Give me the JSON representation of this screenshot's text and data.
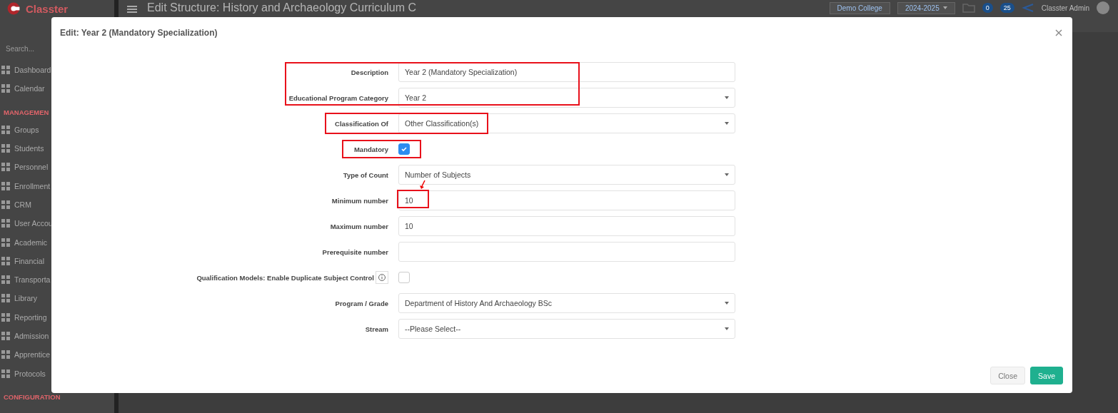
{
  "app": {
    "brand": "Classter",
    "search_placeholder": "Search...",
    "page_title": "Edit Structure: History and Archaeology Curriculum C"
  },
  "sidebar": {
    "items": [
      {
        "kind": "item",
        "label": "Dashboard"
      },
      {
        "kind": "item",
        "label": "Calendar"
      },
      {
        "kind": "heading",
        "label": "MANAGEMEN"
      },
      {
        "kind": "item",
        "label": "Groups"
      },
      {
        "kind": "item",
        "label": "Students"
      },
      {
        "kind": "item",
        "label": "Personnel"
      },
      {
        "kind": "item",
        "label": "Enrollment"
      },
      {
        "kind": "item",
        "label": "CRM"
      },
      {
        "kind": "item",
        "label": "User Accou"
      },
      {
        "kind": "item",
        "label": "Academic"
      },
      {
        "kind": "item",
        "label": "Financial"
      },
      {
        "kind": "item",
        "label": "Transporta"
      },
      {
        "kind": "item",
        "label": "Library"
      },
      {
        "kind": "item",
        "label": "Reporting"
      },
      {
        "kind": "item",
        "label": "Admission"
      },
      {
        "kind": "item",
        "label": "Apprentice"
      },
      {
        "kind": "item",
        "label": "Protocols"
      },
      {
        "kind": "heading",
        "label": "CONFIGURATION"
      }
    ]
  },
  "topbar": {
    "institution": "Demo College",
    "period": "2024-2025",
    "notifications": "0",
    "messages": "25",
    "user": "Classter Admin"
  },
  "dialog": {
    "title": "Edit: Year 2 (Mandatory Specialization)",
    "fields": [
      {
        "kind": "text",
        "label": "Description",
        "value": "Year 2 (Mandatory Specialization)"
      },
      {
        "kind": "select",
        "label": "Educational Program Category",
        "value": "Year 2"
      },
      {
        "kind": "select",
        "label": "Classification Of",
        "value": "Other Classification(s)"
      },
      {
        "kind": "checkbox",
        "label": "Mandatory",
        "checked": true
      },
      {
        "kind": "select",
        "label": "Type of Count",
        "value": "Number of Subjects"
      },
      {
        "kind": "text",
        "label": "Minimum number",
        "value": "10"
      },
      {
        "kind": "text",
        "label": "Maximum number",
        "value": "10"
      },
      {
        "kind": "text",
        "label": "Prerequisite number"
      },
      {
        "kind": "checkbox",
        "label": "Qualification Models: Enable Duplicate Subject Control",
        "checked": false,
        "info": true
      },
      {
        "kind": "select",
        "label": "Program / Grade",
        "value": "Department of History And Archaeology BSc"
      },
      {
        "kind": "select",
        "label": "Stream",
        "value": "--Please Select--"
      }
    ],
    "buttons": [
      {
        "kind": "secondary",
        "label": "Close"
      },
      {
        "kind": "primary",
        "label": "Save"
      }
    ]
  }
}
